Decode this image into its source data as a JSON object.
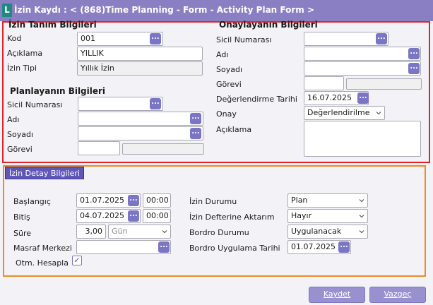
{
  "window": {
    "logo_letter": "L",
    "title": "İzin Kaydı : < (868)Time Planning - Form - Activity Plan Form >"
  },
  "leave_def": {
    "heading": "İzin Tanım Bilgileri",
    "code_label": "Kod",
    "code_value": "001",
    "description_label": "Açıklama",
    "description_value": "YILLIK",
    "type_label": "İzin Tipi",
    "type_value": "Yıllık İzin"
  },
  "planner": {
    "heading": "Planlayanın Bilgileri",
    "registry_label": "Sicil Numarası",
    "name_label": "Adı",
    "surname_label": "Soyadı",
    "role_label": "Görevi"
  },
  "approver": {
    "heading": "Onaylayanın Bilgileri",
    "registry_label": "Sicil Numarası",
    "name_label": "Adı",
    "surname_label": "Soyadı",
    "role_label": "Görevi",
    "eval_date_label": "Değerlendirme Tarihi",
    "eval_date_value": "16.07.2025",
    "approval_label": "Onay",
    "approval_value": "Değerlendirilme",
    "note_label": "Açıklama"
  },
  "detail": {
    "tab_label": "İzin Detay Bilgileri",
    "start_label": "Başlangıç",
    "start_date": "01.07.2025",
    "start_time": "00:00",
    "end_label": "Bitiş",
    "end_date": "04.07.2025",
    "end_time": "00:00",
    "duration_label": "Süre",
    "duration_value": "3,00",
    "duration_unit": "Gün",
    "cost_center_label": "Masraf Merkezi",
    "auto_calc_label": "Otm. Hesapla",
    "auto_calc_checked": true,
    "status_label": "İzin Durumu",
    "status_value": "Plan",
    "transfer_label": "İzin Defterine Aktarım",
    "transfer_value": "Hayır",
    "payroll_status_label": "Bordro Durumu",
    "payroll_status_value": "Uygulanacak",
    "payroll_date_label": "Bordro Uygulama Tarihi",
    "payroll_date_value": "01.07.2025"
  },
  "actions": {
    "save_label": "Kaydet",
    "cancel_label": "Vazgeç"
  },
  "colors": {
    "title_bar": "#8b7fc4",
    "highlight_red": "#e0242b",
    "highlight_orange": "#f08a24",
    "accent": "#7b75c6"
  },
  "icons": {
    "lookup": "ellipsis-lookup-icon",
    "dropdown": "chevron-down-icon",
    "check": "checkmark-icon"
  }
}
